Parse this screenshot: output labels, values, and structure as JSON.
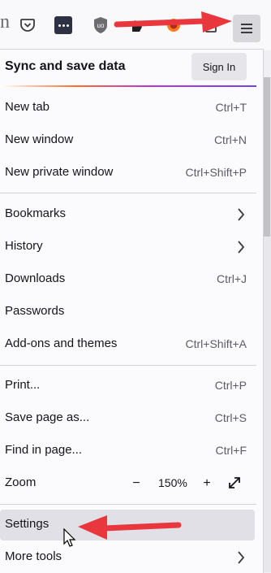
{
  "toolbar": {
    "partial_text": "n",
    "icons": [
      "pocket-icon",
      "dots-extension-icon",
      "ublock-origin-icon",
      "hand-extension-icon",
      "firefox-extension-icon",
      "lock-extension-icon"
    ],
    "menu_button": "hamburger-menu-icon"
  },
  "sync": {
    "title": "Sync and save data",
    "signin_label": "Sign In"
  },
  "menu": {
    "new_tab": {
      "label": "New tab",
      "shortcut": "Ctrl+T"
    },
    "new_window": {
      "label": "New window",
      "shortcut": "Ctrl+N"
    },
    "new_private_window": {
      "label": "New private window",
      "shortcut": "Ctrl+Shift+P"
    },
    "bookmarks": {
      "label": "Bookmarks"
    },
    "history": {
      "label": "History"
    },
    "downloads": {
      "label": "Downloads",
      "shortcut": "Ctrl+J"
    },
    "passwords": {
      "label": "Passwords"
    },
    "addons": {
      "label": "Add-ons and themes",
      "shortcut": "Ctrl+Shift+A"
    },
    "print": {
      "label": "Print...",
      "shortcut": "Ctrl+P"
    },
    "save_page": {
      "label": "Save page as...",
      "shortcut": "Ctrl+S"
    },
    "find": {
      "label": "Find in page...",
      "shortcut": "Ctrl+F"
    },
    "zoom": {
      "label": "Zoom",
      "minus": "−",
      "value": "150%",
      "plus": "+"
    },
    "settings": {
      "label": "Settings"
    },
    "more_tools": {
      "label": "More tools"
    }
  },
  "colors": {
    "annotation_arrow": "#e8383d",
    "gradient": [
      "#ff6a28",
      "#b833e1",
      "#7542e5"
    ]
  }
}
